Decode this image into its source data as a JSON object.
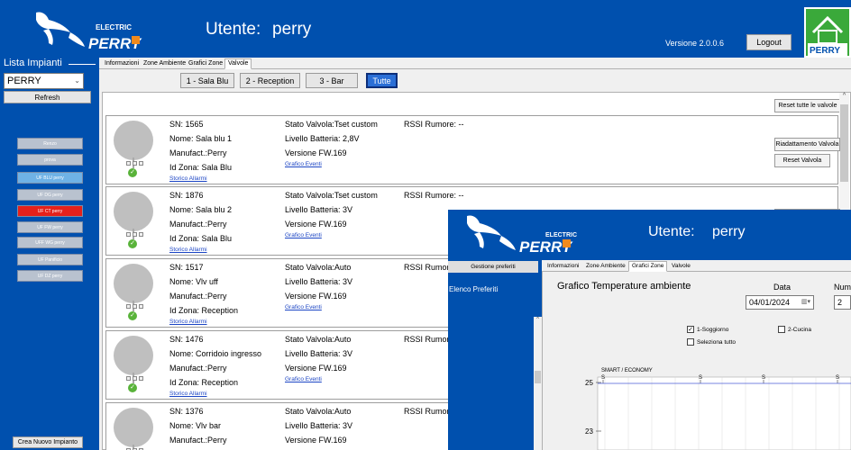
{
  "app": {
    "brand_electric": "ELECTRIC",
    "user_label": "Utente:",
    "user_name": "perry",
    "version": "Versione 2.0.0.6",
    "logout_label": "Logout"
  },
  "sidebar": {
    "plants_legend": "Lista Impianti",
    "selected_plant": "PERRY",
    "refresh_label": "Refresh",
    "plant_buttons": [
      {
        "label": "Renzo",
        "color": "#b9c2cf"
      },
      {
        "label": "prova",
        "color": "#b9c2cf"
      },
      {
        "label": "UF BLU perry",
        "color": "#6fb2e6"
      },
      {
        "label": "UF DG perry",
        "color": "#b9c2cf"
      },
      {
        "label": "UF CT perry",
        "color": "#e5211b"
      },
      {
        "label": "UF FW perry",
        "color": "#b9c2cf"
      },
      {
        "label": "UFF WG perry",
        "color": "#b9c2cf"
      },
      {
        "label": "UF Panificio",
        "color": "#b9c2cf"
      },
      {
        "label": "UF DZ perry",
        "color": "#b9c2cf"
      }
    ],
    "new_plant_label": "Crea Nuovo Impianto"
  },
  "tabs": [
    {
      "label": "Informazioni",
      "active": false
    },
    {
      "label": "Zone Ambiente",
      "active": false
    },
    {
      "label": "Grafici Zone",
      "active": false
    },
    {
      "label": "Valvole",
      "active": true
    }
  ],
  "filters": [
    {
      "label": "1 - Sala Blu",
      "active": false
    },
    {
      "label": "2 - Reception",
      "active": false
    },
    {
      "label": "3 - Bar",
      "active": false
    },
    {
      "label": "Tutte",
      "active": true
    }
  ],
  "reset_all_label": "Reset tutte le valvole",
  "valve_side_buttons": {
    "recalibrate": "Riadattamento Valvola",
    "reset": "Reset Valvola"
  },
  "valves": [
    {
      "sn": "SN: 1565",
      "name": "Nome: Sala blu 1",
      "manufact": "Manufact.:Perry",
      "zone": "Id Zona: Sala Blu",
      "state": "Stato Valvola:Tset custom",
      "battery": "Livello Batteria: 2,8V",
      "fw": "Versione FW.169",
      "events": "Grafico Eventi",
      "alarms": "Storico Allarmi",
      "rssi": "RSSI Rumore: --"
    },
    {
      "sn": "SN: 1876",
      "name": "Nome: Sala blu 2",
      "manufact": "Manufact.:Perry",
      "zone": "Id Zona: Sala Blu",
      "state": "Stato Valvola:Tset custom",
      "battery": "Livello Batteria: 3V",
      "fw": "Versione FW.169",
      "events": "Grafico Eventi",
      "alarms": "Storico Allarmi",
      "rssi": "RSSI Rumore: --"
    },
    {
      "sn": "SN: 1517",
      "name": "Nome: Vlv uff",
      "manufact": "Manufact.:Perry",
      "zone": "Id Zona: Reception",
      "state": "Stato Valvola:Auto",
      "battery": "Livello Batteria: 3V",
      "fw": "Versione FW.169",
      "events": "Grafico Eventi",
      "alarms": "Storico Allarmi",
      "rssi": "RSSI Rumor"
    },
    {
      "sn": "SN: 1476",
      "name": "Nome: Corridoio ingresso",
      "manufact": "Manufact.:Perry",
      "zone": "Id Zona: Reception",
      "state": "Stato Valvola:Auto",
      "battery": "Livello Batteria: 3V",
      "fw": "Versione FW.169",
      "events": "Grafico Eventi",
      "alarms": "Storico Allarmi",
      "rssi": "RSSI Rumor"
    },
    {
      "sn": "SN: 1376",
      "name": "Nome: Vlv bar",
      "manufact": "Manufact.:Perry",
      "zone": "",
      "state": "Stato Valvola:Auto",
      "battery": "Livello Batteria: 3V",
      "fw": "Versione FW.169",
      "events": "",
      "alarms": "",
      "rssi": "RSSI Rumor"
    }
  ],
  "overlay": {
    "brand_electric": "ELECTRIC",
    "user_label": "Utente:",
    "user_name": "perry",
    "favorites_tab": "Gestione preferiti",
    "favorites_list": "Elenco Preferiti",
    "tabs": [
      {
        "label": "Informazioni",
        "active": false
      },
      {
        "label": "Zone Ambiente",
        "active": false
      },
      {
        "label": "Grafici Zone",
        "active": true
      },
      {
        "label": "Valvole",
        "active": false
      }
    ],
    "graph_title": "Grafico Temperature ambiente",
    "date_label": "Data",
    "date_value": "04/01/2024",
    "num_label": "Num",
    "num_value": "2",
    "checkboxes": [
      {
        "label": "1-Soggiorno",
        "checked": true
      },
      {
        "label": "2-Cucina",
        "checked": false
      },
      {
        "label": "Seleziona tutto",
        "checked": false
      }
    ]
  },
  "chart_data": {
    "type": "line",
    "title": "",
    "annotation": "SMART / ECONOMY",
    "markers": [
      "S",
      "S",
      "S",
      "S",
      "S"
    ],
    "yticks": [
      25,
      23
    ],
    "grid": true,
    "series": [],
    "xlabel": "",
    "ylabel": ""
  },
  "colors": {
    "brand_blue": "#0050ae",
    "link": "#1c45c4",
    "ok_green": "#59b33a"
  }
}
